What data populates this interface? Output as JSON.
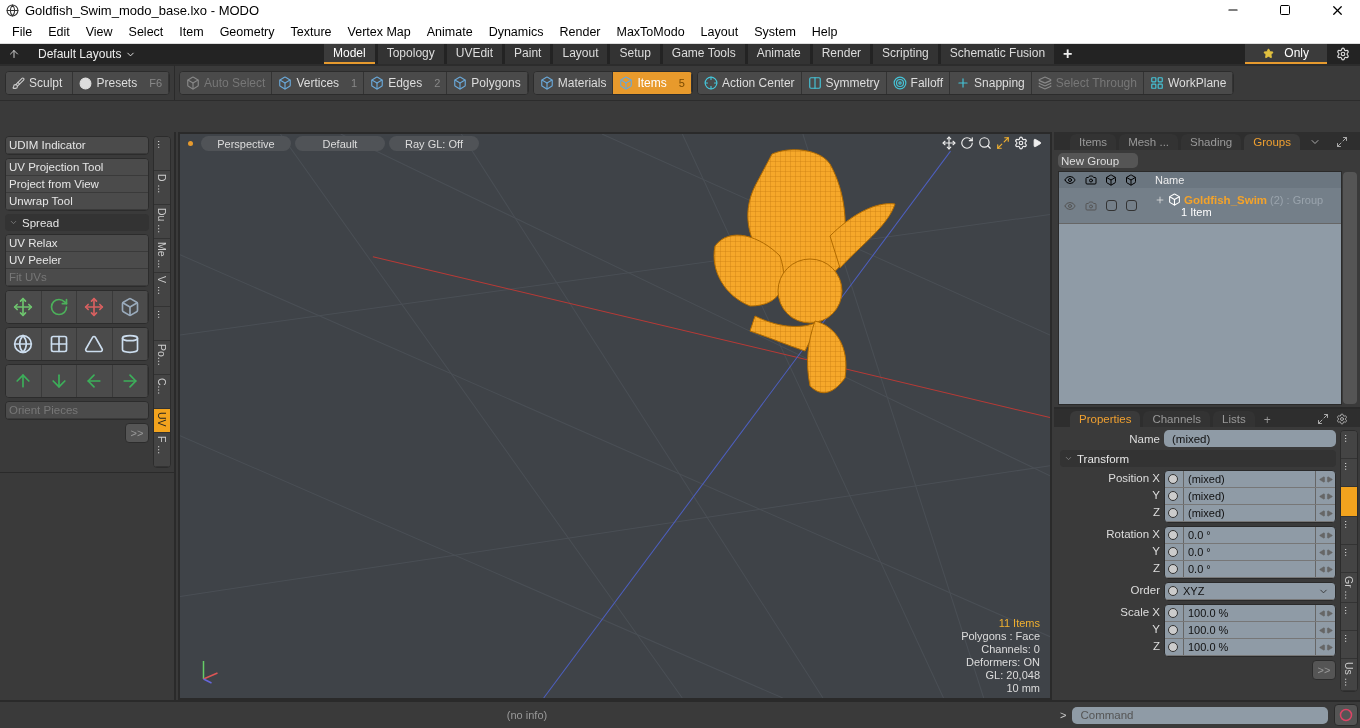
{
  "window": {
    "title": "Goldfish_Swim_modo_base.lxo - MODO"
  },
  "menu": [
    "File",
    "Edit",
    "View",
    "Select",
    "Item",
    "Geometry",
    "Texture",
    "Vertex Map",
    "Animate",
    "Dynamics",
    "Render",
    "MaxToModo",
    "Layout",
    "System",
    "Help"
  ],
  "layout_bar": {
    "layouts": "Default Layouts",
    "tabs": [
      {
        "label": "Model",
        "selected": true
      },
      {
        "label": "Topology",
        "selected": false
      },
      {
        "label": "UVEdit",
        "selected": false
      },
      {
        "label": "Paint",
        "selected": false
      },
      {
        "label": "Layout",
        "selected": false
      },
      {
        "label": "Setup",
        "selected": false
      },
      {
        "label": "Game Tools",
        "selected": false
      },
      {
        "label": "Animate",
        "selected": false
      },
      {
        "label": "Render",
        "selected": false
      },
      {
        "label": "Scripting",
        "selected": false
      },
      {
        "label": "Schematic Fusion",
        "selected": false
      }
    ],
    "add": "+",
    "filter": "Only"
  },
  "toolbar": {
    "left": [
      {
        "label": "Sculpt"
      },
      {
        "label": "Presets",
        "shortcut": "F6"
      }
    ],
    "groups": [
      [
        {
          "label": "Auto Select",
          "disabled": true,
          "selected": false
        },
        {
          "label": "Vertices",
          "shortcut": "1",
          "disabled": false,
          "selected": false
        },
        {
          "label": "Edges",
          "shortcut": "2",
          "disabled": false,
          "selected": false
        },
        {
          "label": "Polygons",
          "disabled": false,
          "selected": false
        }
      ],
      [
        {
          "label": "Materials",
          "disabled": false,
          "selected": false
        },
        {
          "label": "Items",
          "shortcut": "5",
          "disabled": false,
          "selected": true
        }
      ],
      [
        {
          "label": "Action Center",
          "disabled": false,
          "selected": false
        },
        {
          "label": "Symmetry",
          "disabled": false,
          "selected": false
        },
        {
          "label": "Falloff",
          "disabled": false,
          "selected": false
        },
        {
          "label": "Snapping",
          "disabled": false,
          "selected": false
        },
        {
          "label": "Select Through",
          "disabled": true,
          "selected": false
        },
        {
          "label": "WorkPlane",
          "disabled": false,
          "selected": false
        }
      ]
    ]
  },
  "left_panel": {
    "blocks": [
      {
        "kind": "buttons",
        "items": [
          {
            "label": "UDIM Indicator",
            "disabled": false
          }
        ]
      },
      {
        "kind": "buttons",
        "items": [
          {
            "label": "UV Projection Tool",
            "disabled": false
          },
          {
            "label": "Project from View",
            "disabled": false
          },
          {
            "label": "Unwrap Tool",
            "disabled": false
          }
        ]
      },
      {
        "kind": "section",
        "label": "Spread",
        "expanded": true
      },
      {
        "kind": "buttons",
        "items": [
          {
            "label": "UV Relax",
            "disabled": false
          },
          {
            "label": "UV Peeler",
            "disabled": false
          },
          {
            "label": "Fit UVs",
            "disabled": true
          }
        ]
      },
      {
        "kind": "icons"
      },
      {
        "kind": "icons"
      },
      {
        "kind": "icons"
      },
      {
        "kind": "buttons",
        "items": [
          {
            "label": "Orient Pieces",
            "disabled": true
          }
        ]
      },
      {
        "kind": "more",
        "label": ">>"
      }
    ],
    "side_tabs": [
      {
        "label": "...",
        "selected": false
      },
      {
        "label": "D ...",
        "selected": false
      },
      {
        "label": "Du ...",
        "selected": false
      },
      {
        "label": "Me ...",
        "selected": false
      },
      {
        "label": "V ...",
        "selected": false
      },
      {
        "label": "...",
        "selected": false
      },
      {
        "label": "Po...",
        "selected": false
      },
      {
        "label": "C...",
        "selected": false
      },
      {
        "label": "UV",
        "selected": true
      },
      {
        "label": "F ...",
        "selected": false
      }
    ]
  },
  "viewport": {
    "buttons": [
      "Perspective",
      "Default",
      "Ray GL: Off"
    ],
    "info": [
      {
        "text": "11 Items",
        "highlight": true
      },
      {
        "text": "Polygons : Face",
        "highlight": false
      },
      {
        "text": "Channels: 0",
        "highlight": false
      },
      {
        "text": "Deformers: ON",
        "highlight": false
      },
      {
        "text": "GL: 20,048",
        "highlight": false
      },
      {
        "text": "10 mm",
        "highlight": false
      }
    ]
  },
  "groups_panel": {
    "tabs": [
      {
        "label": "Items",
        "selected": false
      },
      {
        "label": "Mesh ...",
        "selected": false
      },
      {
        "label": "Shading",
        "selected": false
      },
      {
        "label": "Groups",
        "selected": true
      }
    ],
    "new_group": "New Group",
    "name_column": "Name",
    "rows": [
      {
        "name": "Goldfish_Swim",
        "count": "(2)",
        "type": ": Group",
        "detail": "1 Item",
        "expanded": false,
        "locked": false,
        "selectable": false
      }
    ]
  },
  "properties": {
    "tabs": [
      {
        "label": "Properties",
        "selected": true
      },
      {
        "label": "Channels",
        "selected": false
      },
      {
        "label": "Lists",
        "selected": false
      }
    ],
    "add": "+",
    "name_label": "Name",
    "name_value": "(mixed)",
    "section": "Transform",
    "section_expanded": true,
    "groups": [
      {
        "kind": "vector",
        "rows": [
          {
            "label": "Position X",
            "value": "(mixed)"
          },
          {
            "label": "Y",
            "value": "(mixed)"
          },
          {
            "label": "Z",
            "value": "(mixed)"
          }
        ]
      },
      {
        "kind": "vector",
        "rows": [
          {
            "label": "Rotation X",
            "value": "0.0 °"
          },
          {
            "label": "Y",
            "value": "0.0 °"
          },
          {
            "label": "Z",
            "value": "0.0 °"
          }
        ]
      },
      {
        "kind": "dropdown",
        "rows": [
          {
            "label": "Order",
            "value": "XYZ"
          }
        ]
      },
      {
        "kind": "vector",
        "rows": [
          {
            "label": "Scale X",
            "value": "100.0 %"
          },
          {
            "label": "Y",
            "value": "100.0 %"
          },
          {
            "label": "Z",
            "value": "100.0 %"
          }
        ]
      }
    ],
    "more": ">>",
    "side_tabs": [
      {
        "label": "...",
        "selected": false
      },
      {
        "label": "...",
        "selected": false
      },
      {
        "selected": true
      },
      {
        "label": "...",
        "selected": false
      },
      {
        "label": "...",
        "selected": false
      },
      {
        "label": "Gr ...",
        "selected": false
      },
      {
        "label": "...",
        "selected": false
      },
      {
        "label": "...",
        "selected": false
      },
      {
        "label": "Us ...",
        "selected": false
      }
    ]
  },
  "status_bar": {
    "info": "(no info)",
    "prompt": ">",
    "command_placeholder": "Command"
  }
}
